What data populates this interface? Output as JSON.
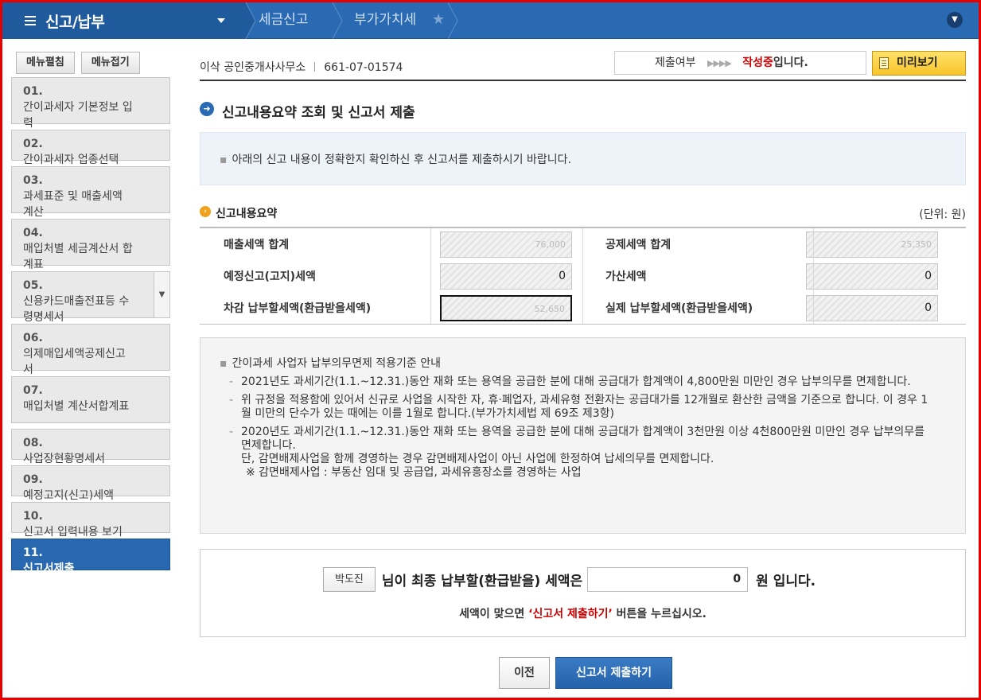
{
  "topbar": {
    "menu_title": "신고/납부",
    "crumbs": [
      "세금신고",
      "부가가치세"
    ]
  },
  "sidebar": {
    "expand_label": "메뉴펼침",
    "collapse_label": "메뉴접기",
    "items": [
      {
        "num": "01.",
        "label": "간이과세자 기본정보 입력"
      },
      {
        "num": "02.",
        "label": "간이과세자 업종선택"
      },
      {
        "num": "03.",
        "label": "과세표준 및 매출세액 계산"
      },
      {
        "num": "04.",
        "label": "매입처별 세금계산서 합계표"
      },
      {
        "num": "05.",
        "label": "신용카드매출전표등 수령명세서"
      },
      {
        "num": "06.",
        "label": "의제매입세액공제신고서"
      },
      {
        "num": "07.",
        "label": "매입처별 계산서합계표"
      },
      {
        "num": "08.",
        "label": "사업장현황명세서"
      },
      {
        "num": "09.",
        "label": "예정고지(신고)세액"
      },
      {
        "num": "10.",
        "label": "신고서 입력내용 보기"
      },
      {
        "num": "11.",
        "label": "신고서제출"
      }
    ]
  },
  "header": {
    "business_name": "이삭 공인중개사사무소",
    "business_no": "661-07-01574",
    "status_label": "제출여부",
    "status_value": "작성중",
    "status_suffix": "입니다.",
    "preview_label": "미리보기"
  },
  "main": {
    "section_title": "신고내용요약 조회 및 신고서 제출",
    "info_text": "아래의 신고 내용이 정확한지 확인하신 후 신고서를 제출하시기 바랍니다.",
    "summary_title": "신고내용요약",
    "unit_label": "(단위: 원)",
    "summary": {
      "sales_tax_total_label": "매출세액 합계",
      "sales_tax_total_value": "76,000",
      "deduction_tax_total_label": "공제세액 합계",
      "deduction_tax_total_value": "25,350",
      "prelim_tax_label": "예정신고(고지)세액",
      "prelim_tax_value": "0",
      "additional_tax_label": "가산세액",
      "additional_tax_value": "0",
      "net_payable_label": "차감 납부할세액(환급받을세액)",
      "net_payable_value": "52,650",
      "actual_payable_label": "실제 납부할세액(환급받을세액)",
      "actual_payable_value": "0"
    },
    "notice": {
      "head": "간이과세 사업자 납부의무면제 적용기준 안내",
      "item1": "2021년도 과세기간(1.1.~12.31.)동안 재화 또는 용역을 공급한 분에 대해 공급대가 합계액이 4,800만원 미만인 경우 납부의무를 면제합니다.",
      "item2": "위 규정을 적용함에 있어서 신규로 사업을 시작한 자, 휴·폐업자, 과세유형 전환자는 공급대가를 12개월로 환산한 금액을 기준으로 합니다. 이 경우 1월 미만의 단수가 있는 때에는 이를 1월로 합니다.(부가가치세법 제 69조 제3항)",
      "item3": "2020년도 과세기간(1.1.~12.31.)동안 재화 또는 용역을 공급한 분에 대해 공급대가 합계액이 3천만원 이상 4천800만원 미만인 경우 납부의무를 면제합니다.",
      "item3_sub": "단, 감면배제사업을 함께 경영하는 경우 감면배제사업이 아닌 사업에 한정하여 납세의무를 면제합니다.",
      "item3_sub2": "※ 감면배제사업 : 부동산 임대 및 공급업, 과세유흥장소를 경영하는 사업"
    },
    "final": {
      "name": "박도진",
      "text1": "님이 최종 납부할(환급받을) 세액은",
      "amount": "0",
      "text2": "원 입니다.",
      "note_prefix": "세액이 맞으면 ",
      "note_highlight": "‘신고서 제출하기’",
      "note_suffix": " 버튼을 누르십시오."
    },
    "buttons": {
      "prev_label": "이전",
      "submit_label": "신고서 제출하기"
    }
  }
}
